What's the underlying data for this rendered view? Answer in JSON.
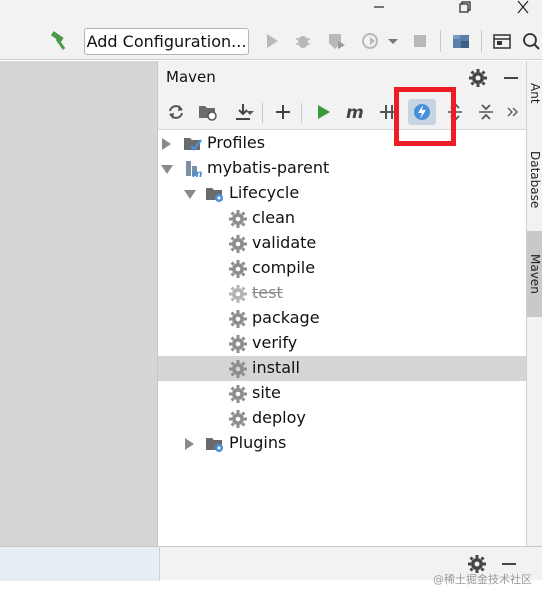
{
  "toolbar": {
    "add_config_label": "Add Configuration..."
  },
  "maven": {
    "title": "Maven",
    "tree": [
      {
        "label": "Profiles",
        "level": 0,
        "expanded": false,
        "icon": "profiles-icon"
      },
      {
        "label": "mybatis-parent",
        "level": 0,
        "expanded": true,
        "icon": "maven-module-icon"
      },
      {
        "label": "Lifecycle",
        "level": 1,
        "expanded": true,
        "icon": "lifecycle-folder-icon"
      },
      {
        "label": "clean",
        "level": 2,
        "icon": "gear-icon"
      },
      {
        "label": "validate",
        "level": 2,
        "icon": "gear-icon"
      },
      {
        "label": "compile",
        "level": 2,
        "icon": "gear-icon"
      },
      {
        "label": "test",
        "level": 2,
        "icon": "gear-icon",
        "skipped": true
      },
      {
        "label": "package",
        "level": 2,
        "icon": "gear-icon"
      },
      {
        "label": "verify",
        "level": 2,
        "icon": "gear-icon"
      },
      {
        "label": "install",
        "level": 2,
        "icon": "gear-icon",
        "selected": true
      },
      {
        "label": "site",
        "level": 2,
        "icon": "gear-icon"
      },
      {
        "label": "deploy",
        "level": 2,
        "icon": "gear-icon"
      },
      {
        "label": "Plugins",
        "level": 1,
        "expanded": false,
        "icon": "plugins-folder-icon"
      }
    ]
  },
  "right_stripe": {
    "tabs": [
      "Ant",
      "Database",
      "Maven"
    ]
  },
  "watermark": "@稀土掘金技术社区",
  "colors": {
    "highlight": "#ee1c24",
    "run_green": "#3c9a3c",
    "selected_row": "#d5d5d5"
  }
}
